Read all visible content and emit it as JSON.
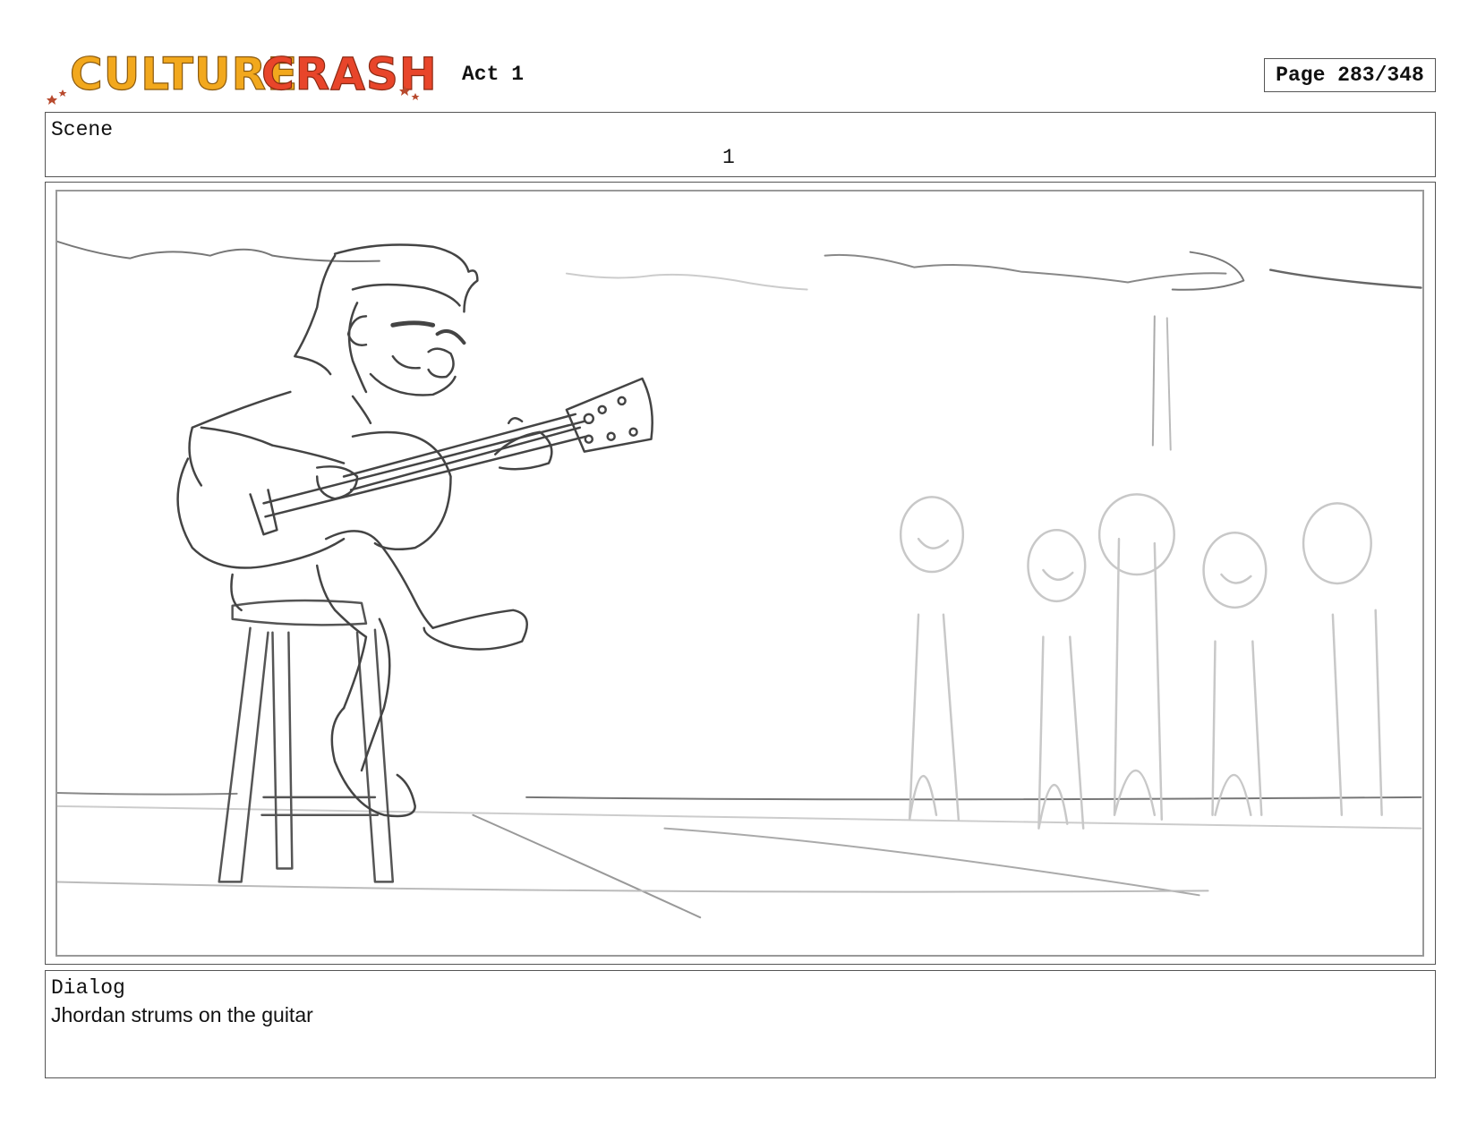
{
  "header": {
    "logo_text": "CULTURE CRASH",
    "logo_word1": "CULTURE",
    "logo_word2": "CRASH",
    "act_label": "Act 1",
    "page_label": "Page 283/348"
  },
  "scene": {
    "label": "Scene",
    "number": "1"
  },
  "panel": {
    "image_subject": "storyboard-sketch"
  },
  "dialog": {
    "label": "Dialog",
    "text": "Jhordan strums on the guitar"
  },
  "colors": {
    "logo_yellow": "#f2a81d",
    "logo_red": "#e8452a",
    "logo_star": "#b84a2e",
    "sketch_dark": "#555555",
    "sketch_light": "#c8c8c8"
  }
}
